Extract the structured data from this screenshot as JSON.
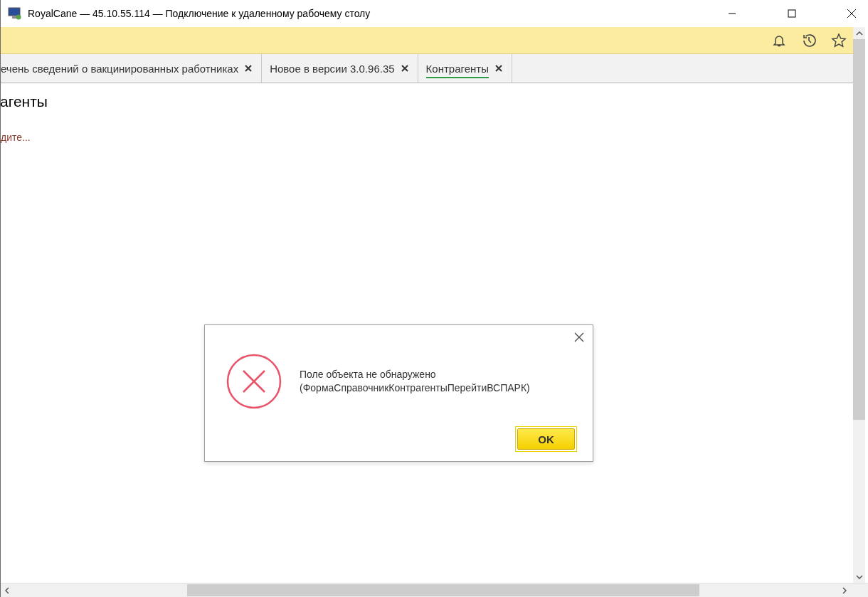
{
  "window": {
    "title": "RoyalCane — 45.10.55.114 — Подключение к удаленному рабочему столу"
  },
  "tabs": [
    {
      "label": "ечень сведений о вакцинированных работниках",
      "selected": false
    },
    {
      "label": "Новое в версии 3.0.96.35",
      "selected": false
    },
    {
      "label": "Контрагенты",
      "selected": true
    }
  ],
  "page": {
    "title": "агенты",
    "hint": "дите..."
  },
  "dialog": {
    "message_lines": [
      "Поле объекта не обнаружено",
      "(ФормаСправочникКонтрагентыПерейтиВСПАРК)"
    ],
    "button": "OK"
  }
}
